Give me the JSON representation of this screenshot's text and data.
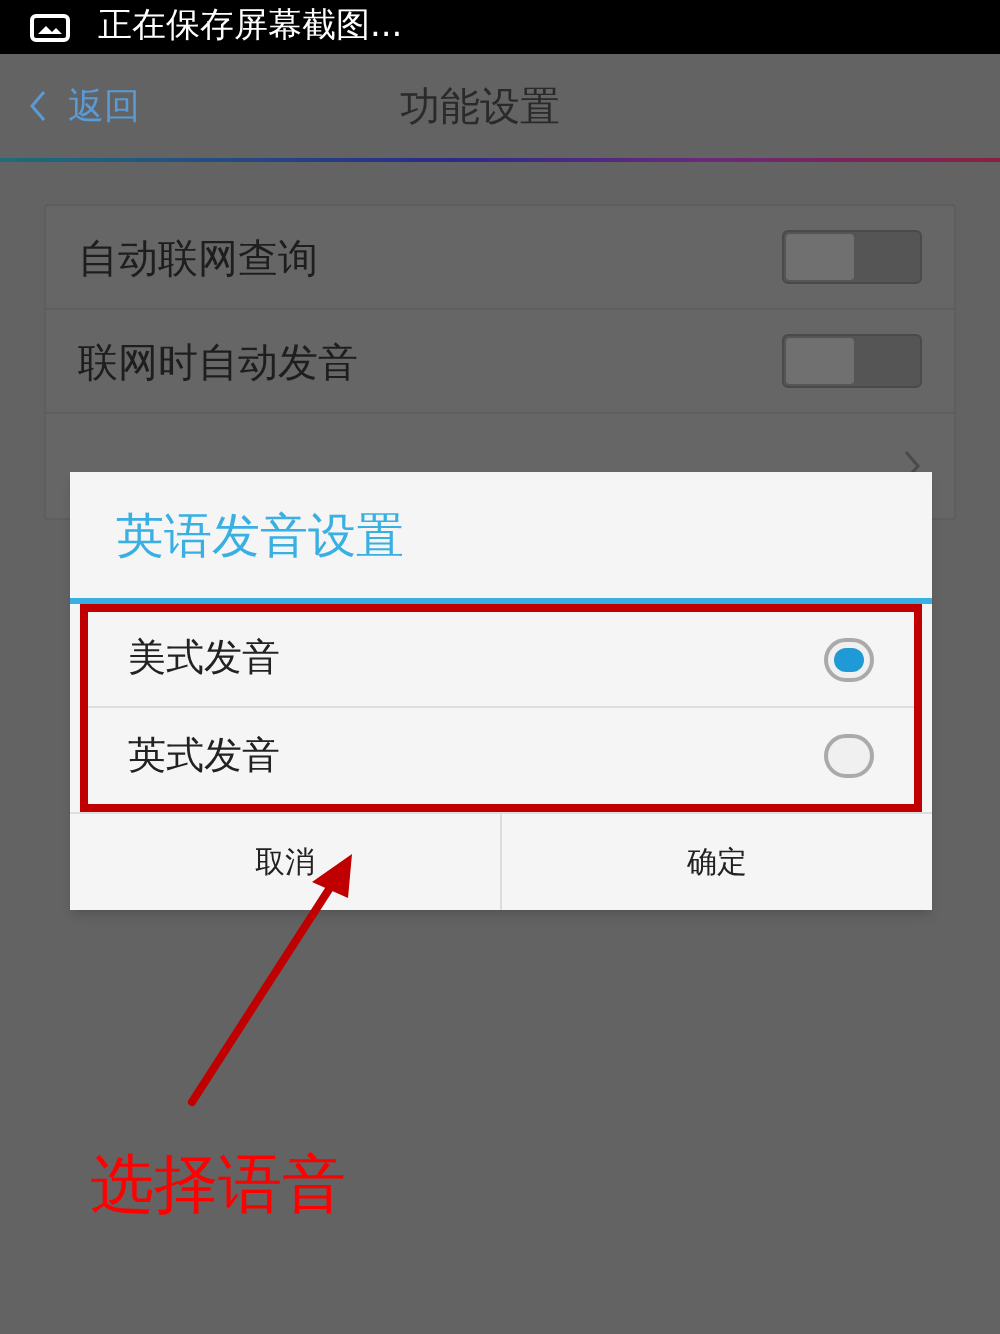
{
  "status_bar": {
    "text": "正在保存屏幕截图..."
  },
  "header": {
    "back": "返回",
    "title": "功能设置"
  },
  "settings": [
    {
      "kind": "toggle",
      "label": "自动联网查询",
      "on": false
    },
    {
      "kind": "toggle",
      "label": "联网时自动发音",
      "on": false
    },
    {
      "kind": "link"
    }
  ],
  "dialog": {
    "title": "英语发音设置",
    "options": [
      {
        "label": "美式发音",
        "selected": true
      },
      {
        "label": "英式发音",
        "selected": false
      }
    ],
    "buttons": [
      "取消",
      "确定"
    ]
  },
  "annotation": {
    "text": "选择语音"
  }
}
